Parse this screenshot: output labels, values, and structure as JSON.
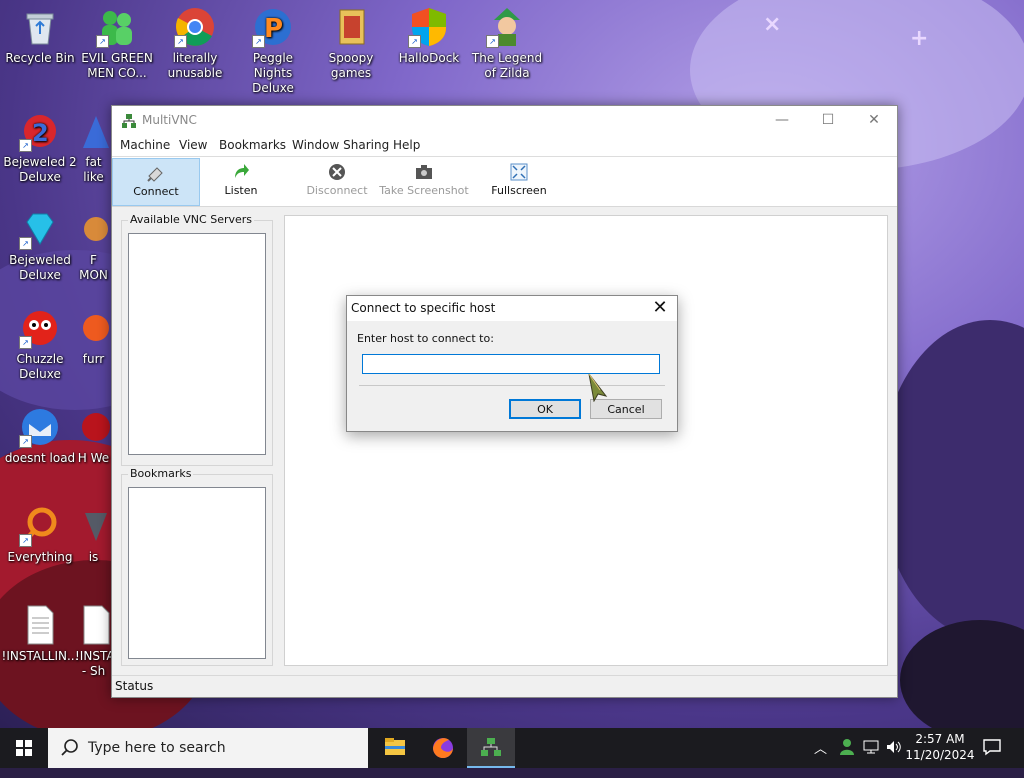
{
  "desktop": {
    "icons": [
      {
        "label": "Recycle Bin"
      },
      {
        "label": "EVIL GREEN MEN CO..."
      },
      {
        "label": "literally unusable"
      },
      {
        "label": "Peggle Nights Deluxe"
      },
      {
        "label": "Spoopy games"
      },
      {
        "label": "HalloDock"
      },
      {
        "label": "The Legend of Zilda"
      },
      {
        "label": "Bejeweled 2 Deluxe"
      },
      {
        "label": "fat like"
      },
      {
        "label": "Bejeweled Deluxe"
      },
      {
        "label": "F MON"
      },
      {
        "label": "Chuzzle Deluxe"
      },
      {
        "label": "furr"
      },
      {
        "label": "doesnt load"
      },
      {
        "label": "H We"
      },
      {
        "label": "Everything"
      },
      {
        "label": "is"
      },
      {
        "label": "!INSTALLIN..."
      },
      {
        "label": "!INSTA - Sh"
      }
    ]
  },
  "window": {
    "title": "MultiVNC",
    "menu": [
      "Machine",
      "View",
      "Bookmarks",
      "Window Sharing",
      "Help"
    ],
    "toolbar": {
      "connect": "Connect",
      "listen": "Listen",
      "disconnect": "Disconnect",
      "screenshot": "Take Screenshot",
      "fullscreen": "Fullscreen"
    },
    "available_servers_label": "Available VNC Servers",
    "bookmarks_label": "Bookmarks",
    "status": "Status"
  },
  "dialog": {
    "title": "Connect to specific host",
    "prompt": "Enter host to connect to:",
    "host_value": "",
    "ok_label": "OK",
    "cancel_label": "Cancel"
  },
  "taskbar": {
    "search_placeholder": "Type here to search",
    "time": "2:57 AM",
    "date": "11/20/2024"
  },
  "colors": {
    "accent": "#0078d7",
    "toolbar_active": "#cce4f7",
    "taskbar": "#1b1b1f"
  }
}
